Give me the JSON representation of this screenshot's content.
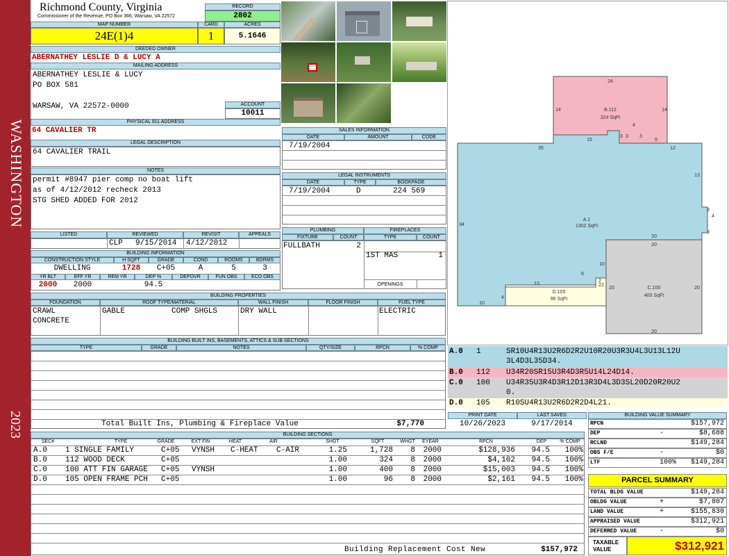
{
  "header": {
    "county": "Richmond County, Virginia",
    "office": "Commissioner of the Revenue, PO Box 366, Warsaw, VA 22572",
    "record_label": "RECORD",
    "record": "2802",
    "map_number_label": "MAP NUMBER",
    "map_number": "24E(1)4",
    "card_label": "CARD",
    "card": "1",
    "acres_label": "ACRES",
    "acres": "5.1646"
  },
  "sidebar": {
    "district": "WASHINGTON",
    "year": "2023"
  },
  "owner": {
    "deeded_label": "DEEDED OWNER",
    "deeded_owner": "ABERNATHEY LESLIE D & LUCY A",
    "mailing_label": "MAILING ADDRESS",
    "mailing_lines": [
      "ABERNATHEY LESLIE & LUCY",
      "PO BOX 581",
      "WARSAW, VA 22572-0000"
    ],
    "account_label": "ACCOUNT",
    "account": "10011",
    "physical_label": "PHYSICAL 911 ADDRESS",
    "physical": "64 CAVALIER TR"
  },
  "legal": {
    "label": "LEGAL DESCRIPTION",
    "text": "64 CAVALIER TRAIL"
  },
  "notes": {
    "label": "NOTES",
    "lines": [
      "permit #8947 pier comp no boat lift",
      "as of 4/12/2012 recheck 2013",
      "STG SHED ADDED FOR 2012"
    ]
  },
  "listing": {
    "listed_label": "LISTED",
    "reviewed_label": "REVIEWED",
    "revisit_label": "REVISIT",
    "appeals_label": "APPEALS",
    "reviewed_by": "CLP",
    "reviewed_date": "9/15/2014",
    "revisit": "4/12/2012"
  },
  "building_info": {
    "label": "BUILDING INFORMATION",
    "h": [
      "CONSTRUCTION STYLE",
      "H SQFT",
      "GRADE",
      "COND",
      "ROOMS",
      "BDRMS"
    ],
    "style": "DWELLING",
    "hsqft": "1728",
    "grade": "C+05",
    "cond": "A",
    "rooms": "5",
    "bdrms": "3",
    "h2": [
      "YR BLT",
      "EFF YR",
      "REM YR",
      "DEP %",
      "DEPOVR",
      "FUN OBS",
      "ECO OBS"
    ],
    "yr_blt": "2000",
    "eff_yr": "2000",
    "dep": "94.5"
  },
  "sales": {
    "label": "SALES INFORMATION",
    "h": [
      "DATE",
      "AMOUNT",
      "CODE"
    ],
    "date": "7/19/2004"
  },
  "instruments": {
    "label": "LEGAL INSTRUMENTS",
    "h": [
      "DATE",
      "TYPE",
      "BOOKPAGE"
    ],
    "date": "7/19/2004",
    "type": "D",
    "bookpage": "224 569"
  },
  "plumbing": {
    "label": "PLUMBING",
    "h": [
      "FIXTURE",
      "COUNT"
    ],
    "fixture": "FULLBATH",
    "count": "2"
  },
  "fireplaces": {
    "label": "FIREPLACES",
    "h": [
      "TYPE",
      "COUNT"
    ],
    "type": "1ST MAS",
    "count": "1",
    "openings": "OPENINGS"
  },
  "properties": {
    "label": "BUILDING PROPERTIES",
    "h": [
      "FOUNDATION",
      "ROOF TYPE/MATERIAL",
      "WALL FINISH",
      "FLOOR FINISH",
      "FUEL TYPE"
    ],
    "foundation": [
      "CRAWL",
      "CONCRETE"
    ],
    "roof_type": "GABLE",
    "roof_mat": "COMP SHGLS",
    "wall": "DRY WALL",
    "fuel": "ELECTRIC"
  },
  "builtins": {
    "label": "BUILDING BUILT INS, BASEMENTS, ATTICS & SUB SECTIONS",
    "h": [
      "TYPE",
      "GRADE",
      "NOTES",
      "QTY/SIZE",
      "RPCN",
      "% COMP"
    ],
    "total_label": "Total Built Ins, Plumbing & Fireplace Value",
    "total": "$7,770"
  },
  "print": {
    "print_label": "PRINT DATE",
    "print_date": "10/26/2023",
    "saved_label": "LAST SAVED",
    "saved_date": "9/17/2014"
  },
  "sections": {
    "label": "BUILDING SECTIONS",
    "h": [
      "SEC#",
      "TYPE",
      "GRADE",
      "EXT FIN",
      "HEAT",
      "AIR",
      "SHGT",
      "SQFT",
      "WHGT",
      "EYEAR",
      "RPCN",
      "DEP",
      "% COMP"
    ],
    "rows": [
      {
        "sec": "A.0",
        "type": "1 SINGLE FAMILY",
        "grade": "C+05",
        "ext": "VYNSH",
        "heat": "C-HEAT",
        "air": "C-AIR",
        "shgt": "1.25",
        "sqft": "1,728",
        "whgt": "8",
        "eyear": "2000",
        "rpcn": "$128,936",
        "dep": "94.5",
        "comp": "100%"
      },
      {
        "sec": "B.0",
        "type": "112 WOOD DECK",
        "grade": "C+05",
        "ext": "",
        "heat": "",
        "air": "",
        "shgt": "1.00",
        "sqft": "324",
        "whgt": "8",
        "eyear": "2000",
        "rpcn": "$4,102",
        "dep": "94.5",
        "comp": "100%"
      },
      {
        "sec": "C.0",
        "type": "100 ATT FIN GARAGE",
        "grade": "C+05",
        "ext": "VYNSH",
        "heat": "",
        "air": "",
        "shgt": "1.00",
        "sqft": "400",
        "whgt": "8",
        "eyear": "2000",
        "rpcn": "$15,003",
        "dep": "94.5",
        "comp": "100%"
      },
      {
        "sec": "D.0",
        "type": "105 OPEN FRAME PCH",
        "grade": "C+05",
        "ext": "",
        "heat": "",
        "air": "",
        "shgt": "1.00",
        "sqft": "96",
        "whgt": "8",
        "eyear": "2000",
        "rpcn": "$2,161",
        "dep": "94.5",
        "comp": "100%"
      }
    ],
    "replacement_label": "Building Replacement Cost New",
    "replacement": "$157,972"
  },
  "sketch": {
    "areas": [
      {
        "id": "A.1",
        "sqft": "1302 SqFt",
        "color": "#add8e6"
      },
      {
        "id": "B.112",
        "sqft": "324 SqFt",
        "color": "#f4b6c2"
      },
      {
        "id": "C.100",
        "sqft": "400 SqFt",
        "color": "#d3d3d3"
      },
      {
        "id": "D.105",
        "sqft": "96 SqFt",
        "color": "#fffde0"
      }
    ],
    "dims": [
      "24",
      "14",
      "14",
      "15",
      "3",
      "3",
      "4",
      "3",
      "5",
      "35",
      "12",
      "13",
      "3",
      "4",
      "3",
      "34",
      "20",
      "20",
      "10",
      "2",
      "6",
      "13",
      "22",
      "20",
      "20",
      "4",
      "10",
      "20"
    ],
    "vectors": [
      {
        "sec": "A.0",
        "num": "1",
        "lines": [
          "SR10U4R13U2R6D2R2U10R20U3R3U4L3U13L12U",
          "3L4D3L35D34."
        ],
        "color": "#add8e6"
      },
      {
        "sec": "B.0",
        "num": "112",
        "lines": [
          "U34R20SR15U3R4D3R5U14L24D14."
        ],
        "color": "#f4b6c2"
      },
      {
        "sec": "C.0",
        "num": "100",
        "lines": [
          "U34R35U3R4D3R12D13R3D4L3D3SL20D20R20U2",
          "0."
        ],
        "color": "#d3d3d3"
      },
      {
        "sec": "D.0",
        "num": "105",
        "lines": [
          "R10SU4R13U2R6D2R2D4L21."
        ],
        "color": "#fffde0"
      }
    ]
  },
  "bvs": {
    "label": "BUILDING VALUE SUMMARY",
    "rows": [
      {
        "l": "RPCN",
        "s": "",
        "r": "$157,972"
      },
      {
        "l": "DEP",
        "s": "-",
        "r": "$8,688"
      },
      {
        "l": "RCLND",
        "s": "",
        "r": "$149,284"
      },
      {
        "l": "OBS F/E",
        "s": "-",
        "r": "$0"
      },
      {
        "l": "LTF",
        "s": "100%",
        "r": "$149,284"
      }
    ]
  },
  "parcel": {
    "label": "PARCEL SUMMARY",
    "rows": [
      {
        "l": "TOTAL BLDG VALUE",
        "s": "",
        "r": "$149,284"
      },
      {
        "l": "OBLDG VALUE",
        "s": "+",
        "r": "$7,807"
      },
      {
        "l": "LAND VALUE",
        "s": "+",
        "r": "$155,830"
      },
      {
        "l": "APPRAISED VALUE",
        "s": "",
        "r": "$312,921"
      },
      {
        "l": "DEFERRED VALUE",
        "s": "-",
        "r": "$0"
      }
    ],
    "taxable_label": "TAXABLE VALUE",
    "taxable": "$312,921"
  }
}
